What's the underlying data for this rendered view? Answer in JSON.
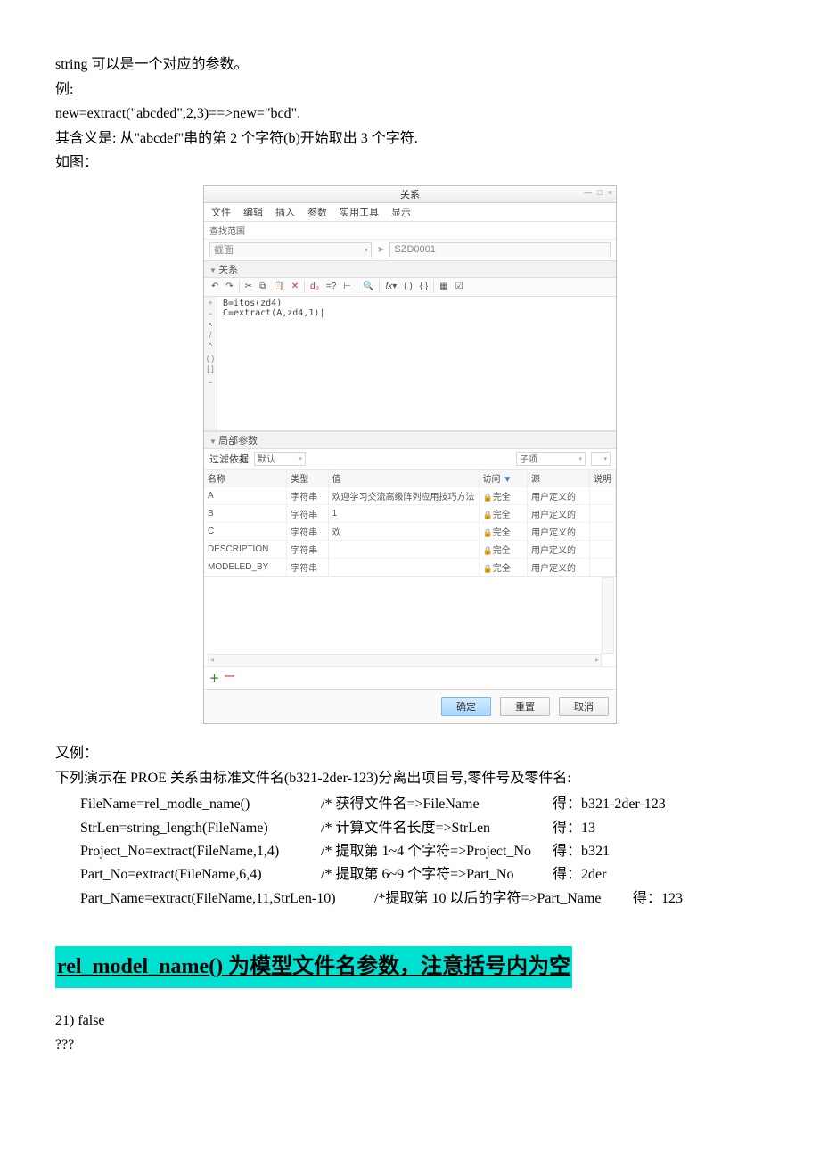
{
  "intro": {
    "l1": "string 可以是一个对应的参数。",
    "l2": "例:",
    "l3": "new=extract(\"abcded\",2,3)==>new=\"bcd\".",
    "l4": "其含义是: 从\"abcdef\"串的第 2 个字符(b)开始取出 3 个字符.",
    "l5": "如图："
  },
  "dialog": {
    "title": "关系",
    "win": {
      "min": "—",
      "max": "□",
      "close": "×"
    },
    "menu": [
      "文件",
      "编辑",
      "插入",
      "参数",
      "实用工具",
      "显示"
    ],
    "scope_label": "查找范围",
    "scope_dd": "截面",
    "scope_obj": "SZD0001",
    "section": "关系",
    "gutter": [
      "+",
      "−",
      "×",
      "/",
      "^",
      "",
      "( )",
      "[ ]",
      "",
      "="
    ],
    "code": "B=itos(zd4)\nC=extract(A,zd4,1)|",
    "local_section": "局部参数",
    "filter_label": "过滤依据",
    "filter_dd": "默认",
    "sub_dd": "子项",
    "columns": [
      "名称",
      "类型",
      "值",
      "访问",
      "源",
      "说明"
    ],
    "rows": [
      {
        "name": "A",
        "type": "字符串",
        "value": "欢迎学习交流高级阵列应用技巧方法",
        "access": "完全",
        "source": "用户定义的"
      },
      {
        "name": "B",
        "type": "字符串",
        "value": "1",
        "access": "完全",
        "source": "用户定义的"
      },
      {
        "name": "C",
        "type": "字符串",
        "value": "欢",
        "access": "完全",
        "source": "用户定义的"
      },
      {
        "name": "DESCRIPTION",
        "type": "字符串",
        "value": "",
        "access": "完全",
        "source": "用户定义的"
      },
      {
        "name": "MODELED_BY",
        "type": "字符串",
        "value": "",
        "access": "完全",
        "source": "用户定义的"
      }
    ],
    "add": "＋",
    "remove": "—",
    "ok": "确定",
    "reset": "重置",
    "cancel": "取消"
  },
  "example2": {
    "head1": "又例：",
    "head2": "下列演示在 PROE 关系由标准文件名(b321-2der-123)分离出项目号,零件号及零件名:",
    "rows": [
      {
        "code": "FileName=rel_modle_name()",
        "cmt": "/* 获得文件名=>FileName",
        "res": "得：b321-2der-123"
      },
      {
        "code": "StrLen=string_length(FileName)",
        "cmt": "/* 计算文件名长度=>StrLen",
        "res": "得：13"
      },
      {
        "code": "Project_No=extract(FileName,1,4)",
        "cmt": "/* 提取第 1~4 个字符=>Project_No",
        "res": "得：b321"
      },
      {
        "code": "Part_No=extract(FileName,6,4)",
        "cmt": "/* 提取第 6~9 个字符=>Part_No",
        "res": "得：2der"
      },
      {
        "code": "Part_Name=extract(FileName,11,StrLen-10)",
        "cmt": "/*提取第 10 以后的字符=>Part_Name",
        "res": "得：123"
      }
    ]
  },
  "highlight": "rel_model_name()  为模型文件名参数，注意括号内为空",
  "tail": {
    "l1": "21)   false",
    "l2": "???"
  }
}
